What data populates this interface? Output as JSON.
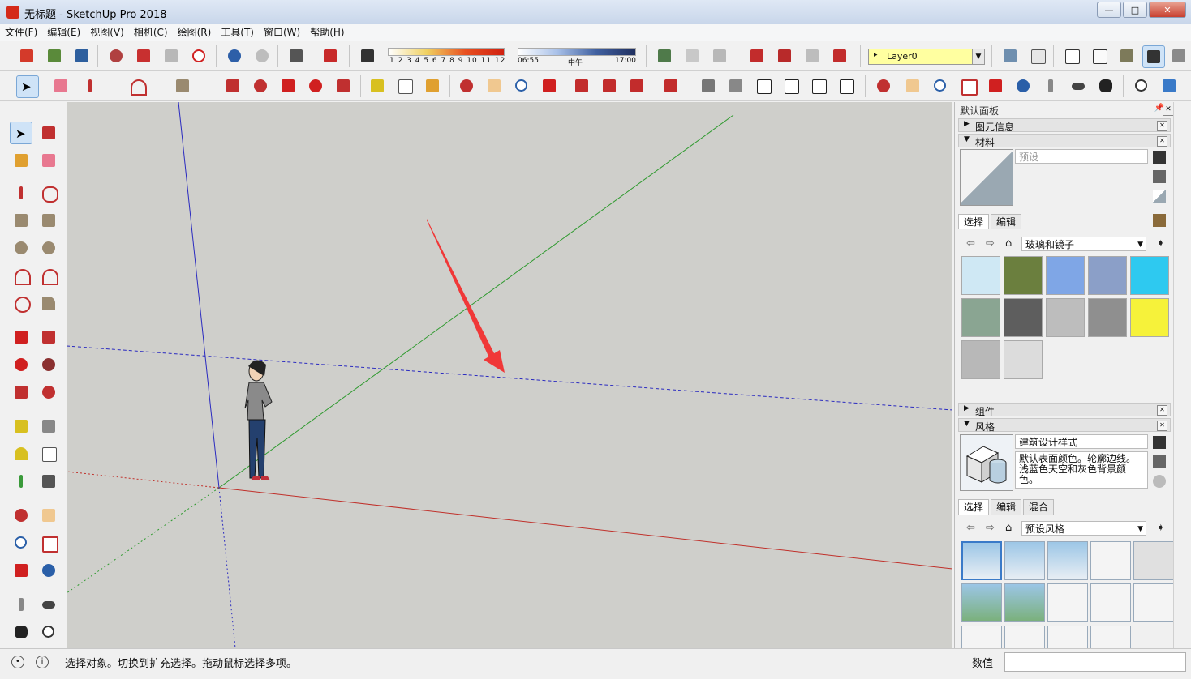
{
  "window": {
    "title": "无标题 - SketchUp Pro 2018"
  },
  "menu": [
    {
      "label": "文件(F)"
    },
    {
      "label": "编辑(E)"
    },
    {
      "label": "视图(V)"
    },
    {
      "label": "相机(C)"
    },
    {
      "label": "绘图(R)"
    },
    {
      "label": "工具(T)"
    },
    {
      "label": "窗口(W)"
    },
    {
      "label": "帮助(H)"
    }
  ],
  "shadows": {
    "months": "1 2 3 4 5 6 7 8 9 10 11 12",
    "time_start": "06:55",
    "time_mid": "中午",
    "time_end": "17:00"
  },
  "layer": {
    "current": "Layer0"
  },
  "tray": {
    "title": "默认面板",
    "entity_info": {
      "label": "图元信息"
    },
    "materials": {
      "label": "材料",
      "name_placeholder": "预设",
      "tabs": [
        "选择",
        "编辑"
      ],
      "library": "玻璃和镜子",
      "swatches": [
        {
          "color": "#cfe8f4"
        },
        {
          "color": "#6b7f3e"
        },
        {
          "color": "#7fa6e6"
        },
        {
          "color": "#8b9fc8"
        },
        {
          "color": "#2ec9f0"
        },
        {
          "color": "#8aa592"
        },
        {
          "color": "#5e5e5e"
        },
        {
          "color": "#bdbdbd"
        },
        {
          "color": "#8f8f8f"
        },
        {
          "color": "#f6f23a"
        },
        {
          "color": "#b8b8b8"
        },
        {
          "color": "#dcdcdc"
        }
      ]
    },
    "components": {
      "label": "组件"
    },
    "styles": {
      "label": "风格",
      "name": "建筑设计样式",
      "description": "默认表面颜色。轮廓边线。浅蓝色天空和灰色背景颜色。",
      "tabs": [
        "选择",
        "编辑",
        "混合"
      ],
      "library": "预设风格"
    }
  },
  "status": {
    "message": "选择对象。切换到扩充选择。拖动鼠标选择多项。",
    "value_label": "数值"
  },
  "colors": {
    "viewport_bg": "#cfcfcb",
    "axis_red": "#c0302a",
    "axis_green": "#2f9a2f",
    "axis_blue": "#2a2ac0",
    "arrow": "#f03838"
  }
}
